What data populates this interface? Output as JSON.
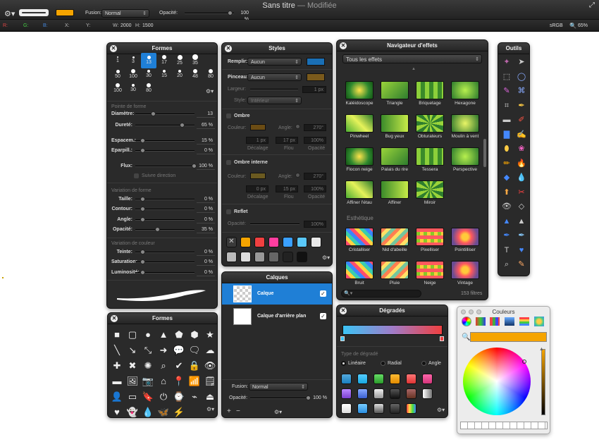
{
  "window": {
    "title": "Sans titre",
    "modified": "— Modifiée"
  },
  "toolbar": {
    "gear_icon": "gear-icon",
    "fusion_label": "Fusion:",
    "fusion_value": "Normal",
    "opacity_label": "Opacité:",
    "opacity_value": "100 %",
    "color_swatch": "#f5a400"
  },
  "infobar": {
    "r": "R:",
    "g": "G:",
    "b": "B:",
    "x": "X:",
    "y": "Y:",
    "w_label": "W:",
    "w_value": "2000",
    "h_label": "H:",
    "h_value": "1500",
    "profile": "sRGB",
    "zoom": "65%"
  },
  "brushes": {
    "title": "Formes",
    "row1": [
      "1",
      "3",
      "13",
      "17",
      "25",
      "35"
    ],
    "row2": [
      "50",
      "100",
      "30",
      "15",
      "20",
      "48",
      "80"
    ],
    "row3": [
      "100",
      "30",
      "80"
    ],
    "selected": "13",
    "shape_section": "Pointe de forme",
    "diametre": {
      "label": "Diamètre:",
      "value": "13"
    },
    "durete": {
      "label": "Dureté:",
      "value": "65 %"
    },
    "espacement": {
      "label": "Espacem.:",
      "value": "15 %"
    },
    "eparpill": {
      "label": "Eparpill.:",
      "value": "0 %"
    },
    "flux": {
      "label": "Flux:",
      "value": "100 %"
    },
    "suivre": "Suivre direction",
    "var_forme": "Variation de forme",
    "taille": {
      "label": "Taille:",
      "value": "0 %"
    },
    "contour": {
      "label": "Contour:",
      "value": "0 %"
    },
    "angle": {
      "label": "Angle:",
      "value": "0 %"
    },
    "opacite": {
      "label": "Opacité:",
      "value": "35 %"
    },
    "var_couleur": "Variation de couleur",
    "teinte": {
      "label": "Teinte:",
      "value": "0 %"
    },
    "saturation": {
      "label": "Saturation:",
      "value": "0 %"
    },
    "luminosite": {
      "label": "Luminosité:",
      "value": "0 %"
    }
  },
  "shapes": {
    "title": "Formes"
  },
  "styles": {
    "title": "Styles",
    "remplir": {
      "label": "Remplir:",
      "value": "Aucun",
      "color": "#1a6fb5"
    },
    "pinceau": {
      "label": "Pinceau:",
      "value": "Aucun",
      "color": "#7a5a1c"
    },
    "largeur": {
      "label": "Largeur:",
      "value": "1 px"
    },
    "style": {
      "label": "Style:",
      "value": "Intérieur"
    },
    "ombre": {
      "title": "Ombre",
      "couleur": "Couleur:",
      "angle": "Angle:",
      "angle_value": "270°",
      "decalage_value": "1 px",
      "flou_value": "17 px",
      "opacite_value": "100%",
      "decalage": "Décalage",
      "flou": "Flou",
      "opacite": "Opacité",
      "color": "#6b4c14"
    },
    "ombre_interne": {
      "title": "Ombre interne",
      "couleur": "Couleur:",
      "angle": "Angle:",
      "angle_value": "270°",
      "decalage_value": "0 px",
      "flou_value": "15 px",
      "opacite_value": "100%",
      "decalage": "Décalage",
      "flou": "Flou",
      "opacite": "Opacité",
      "color": "#6b5a20"
    },
    "reflet": {
      "title": "Reflet",
      "opacite_label": "Opacité:",
      "opacite_value": "100%"
    }
  },
  "layers": {
    "title": "Calques",
    "items": [
      {
        "name": "Calque",
        "checked": "✓"
      },
      {
        "name": "Calque d'arrière plan",
        "checked": "✓"
      }
    ],
    "fusion_label": "Fusion:",
    "fusion_value": "Normal",
    "opacite_label": "Opacité:",
    "opacite_value": "100 %",
    "add": "+",
    "remove": "−"
  },
  "effects": {
    "title": "Navigateur d'effets",
    "filter": "Tous les effets",
    "row1": [
      "Kaléidoscope",
      "Triangle",
      "Briquetage",
      "Hexagone"
    ],
    "row2": [
      "Pinwheel",
      "Bug yeux",
      "Obturateurs",
      "Moulin à vent"
    ],
    "row3": [
      "Flocon neige",
      "Palais du rire",
      "Tessera",
      "Perspective"
    ],
    "row4": [
      "Affiner l'étau",
      "Affiner",
      "Miroir"
    ],
    "section2": "Esthétique",
    "row5": [
      "Cristalliser",
      "Nid d'abeille",
      "Pixelliser",
      "Pointilliser"
    ],
    "row6": [
      "Bruit",
      "Pluie",
      "Neige",
      "Vintage"
    ],
    "count": "153 filtres"
  },
  "gradients": {
    "title": "Dégradés",
    "type_label": "Type de dégradé",
    "lineaire": "Linéaire",
    "radial": "Radial",
    "angle": "Angle"
  },
  "tools": {
    "title": "Outils"
  },
  "colors": {
    "title": "Couleurs",
    "current": "#f5a400"
  }
}
